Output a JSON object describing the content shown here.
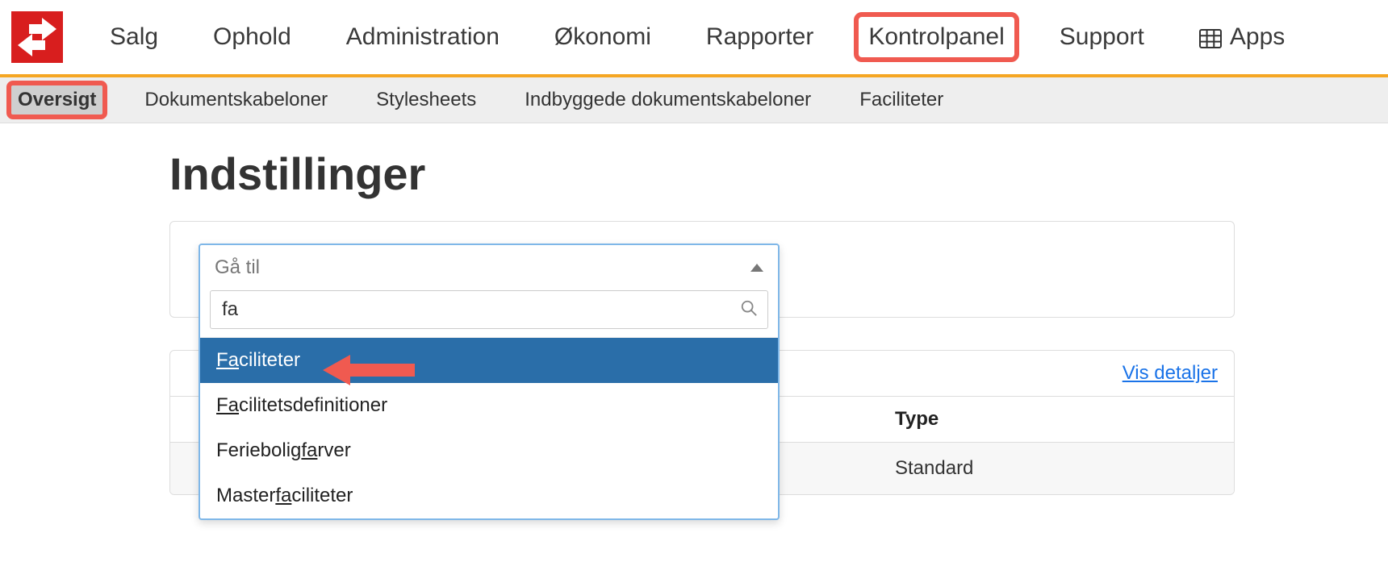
{
  "topnav": {
    "items": [
      {
        "label": "Salg"
      },
      {
        "label": "Ophold"
      },
      {
        "label": "Administration"
      },
      {
        "label": "Økonomi"
      },
      {
        "label": "Rapporter"
      },
      {
        "label": "Kontrolpanel",
        "highlighted": true
      },
      {
        "label": "Support"
      },
      {
        "label": "Apps",
        "icon": "grid"
      }
    ]
  },
  "subnav": {
    "items": [
      {
        "label": "Oversigt",
        "active": true,
        "highlighted": true
      },
      {
        "label": "Dokumentskabeloner"
      },
      {
        "label": "Stylesheets"
      },
      {
        "label": "Indbyggede dokumentskabeloner"
      },
      {
        "label": "Faciliteter"
      }
    ]
  },
  "page": {
    "title": "Indstillinger"
  },
  "combo": {
    "placeholder": "Gå til",
    "search_value": "fa",
    "options": [
      {
        "pre": "",
        "match": "Fa",
        "post": "ciliteter",
        "selected": true,
        "arrow": true
      },
      {
        "pre": "",
        "match": "Fa",
        "post": "cilitetsdefinitioner"
      },
      {
        "pre": "Feriebolig",
        "match": "fa",
        "post": "rver"
      },
      {
        "pre": "Master",
        "match": "fa",
        "post": "ciliteter"
      }
    ]
  },
  "table": {
    "details_link": "Vis detaljer",
    "columns": {
      "type": "Type"
    },
    "rows": [
      {
        "type": "Standard"
      }
    ]
  }
}
